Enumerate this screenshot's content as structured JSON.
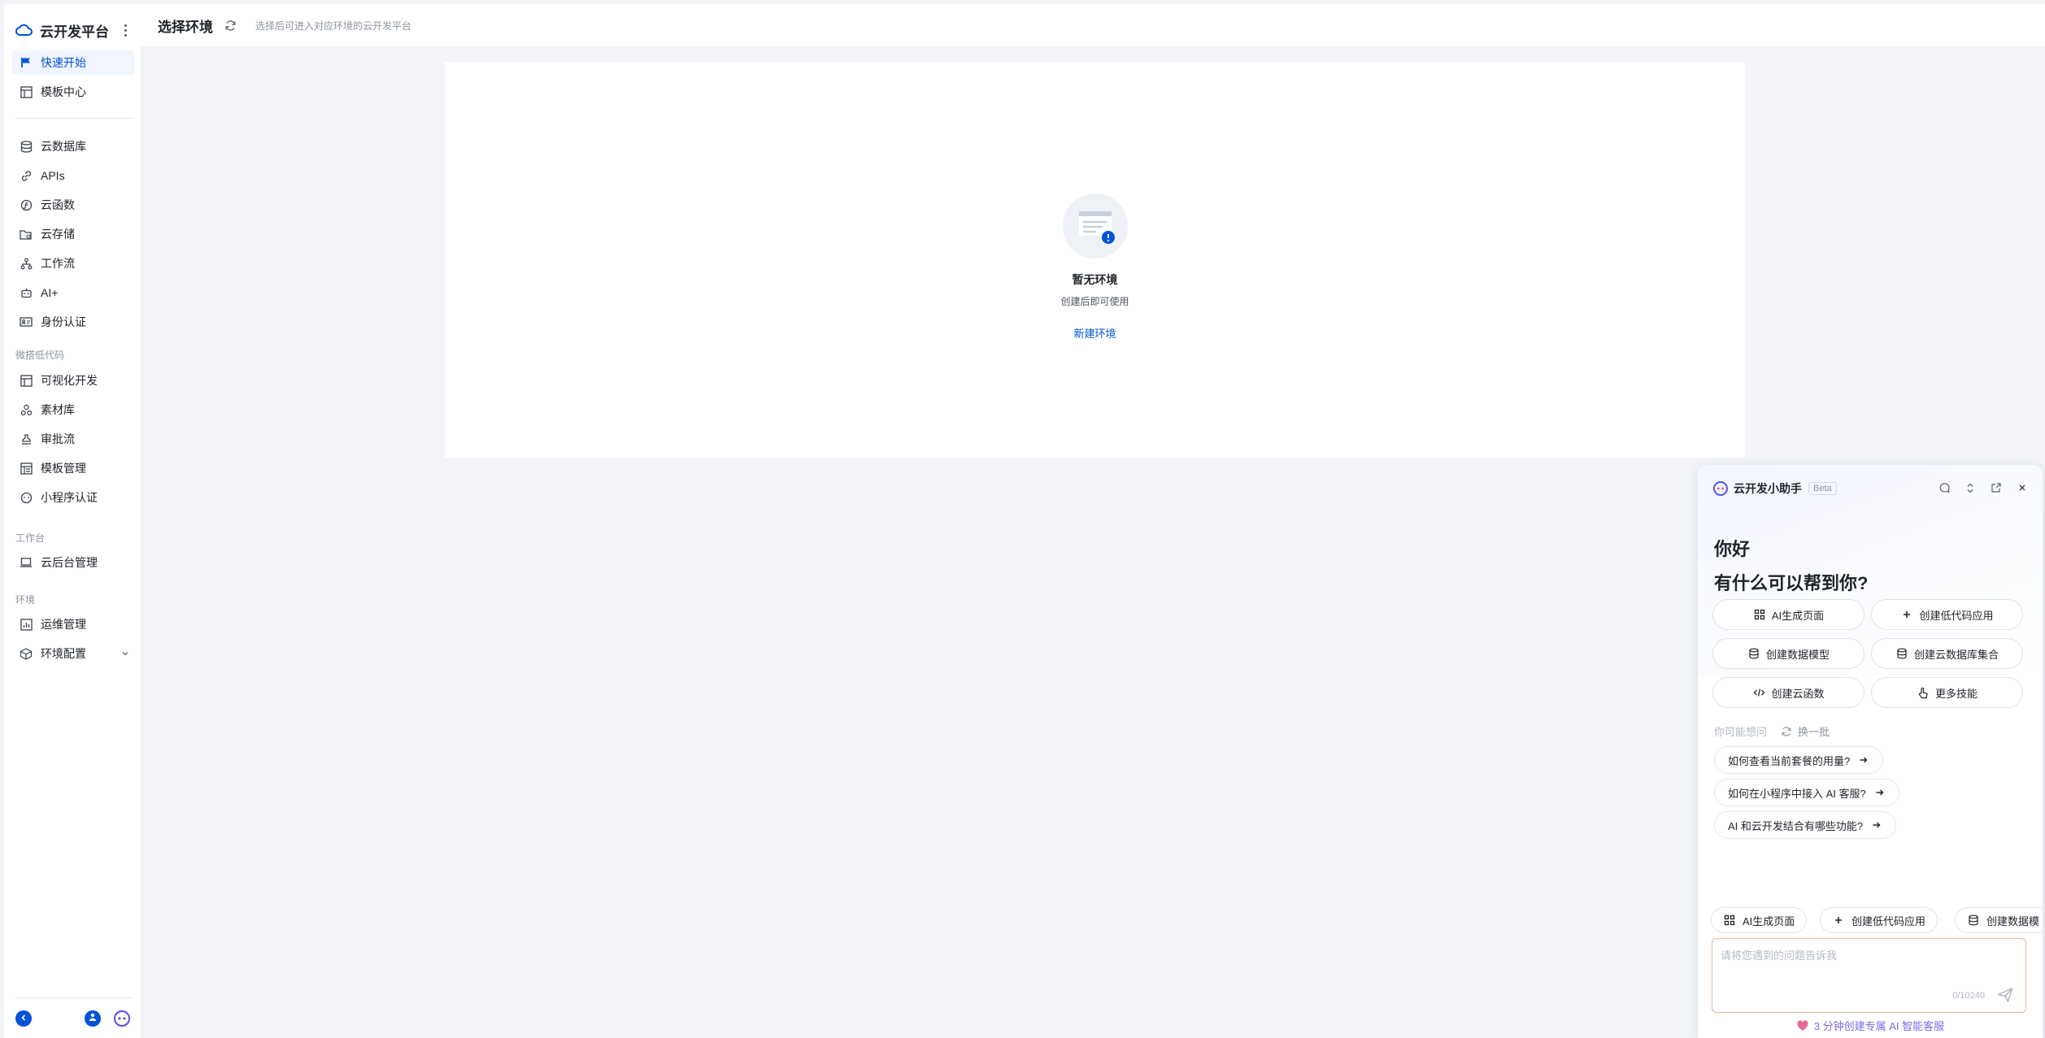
{
  "sidebar": {
    "brand": "云开发平台",
    "items": [
      {
        "label": "快速开始",
        "icon": "flag-icon"
      },
      {
        "label": "模板中心",
        "icon": "template-icon"
      },
      {
        "label": "云数据库",
        "icon": "database-icon"
      },
      {
        "label": "APIs",
        "icon": "link-icon"
      },
      {
        "label": "云函数",
        "icon": "function-icon"
      },
      {
        "label": "云存储",
        "icon": "folder-icon"
      },
      {
        "label": "工作流",
        "icon": "workflow-icon"
      },
      {
        "label": "AI+",
        "icon": "robot-icon"
      },
      {
        "label": "身份认证",
        "icon": "id-card-icon"
      },
      {
        "label": "可视化开发",
        "icon": "layout-icon"
      },
      {
        "label": "素材库",
        "icon": "materials-icon"
      },
      {
        "label": "审批流",
        "icon": "stamp-icon"
      },
      {
        "label": "模板管理",
        "icon": "template-manage-icon"
      },
      {
        "label": "小程序认证",
        "icon": "miniprogram-icon"
      },
      {
        "label": "云后台管理",
        "icon": "laptop-icon"
      },
      {
        "label": "运维管理",
        "icon": "chart-icon"
      },
      {
        "label": "环境配置",
        "icon": "cube-icon"
      }
    ],
    "sections": {
      "lowcode": "微搭低代码",
      "workbench": "工作台",
      "env": "环境"
    }
  },
  "header": {
    "title": "选择环境",
    "description": "选择后可进入对应环境的云开发平台"
  },
  "empty": {
    "title": "暂无环境",
    "subtitle": "创建后即可使用",
    "action": "新建环境"
  },
  "assistant": {
    "title": "云开发小助手",
    "badge": "Beta",
    "greeting": "你好",
    "question": "有什么可以帮到你?",
    "skills": [
      "AI生成页面",
      "创建低代码应用",
      "创建数据模型",
      "创建云数据库集合",
      "创建云函数",
      "更多技能"
    ],
    "maybe_label": "你可能想问",
    "swap_label": "换一批",
    "questions": [
      "如何查看当前套餐的用量?",
      "如何在小程序中接入 AI 客服?",
      "AI 和云开发结合有哪些功能?"
    ],
    "quick": [
      "AI生成页面",
      "创建低代码应用",
      "创建数据模"
    ],
    "input_placeholder": "请将您遇到的问题告诉我",
    "counter": "0/10240",
    "promo": "3 分钟创建专属 AI 智能客服"
  },
  "colors": {
    "accent": "#0052d9",
    "promo": "#7a6cf0"
  }
}
